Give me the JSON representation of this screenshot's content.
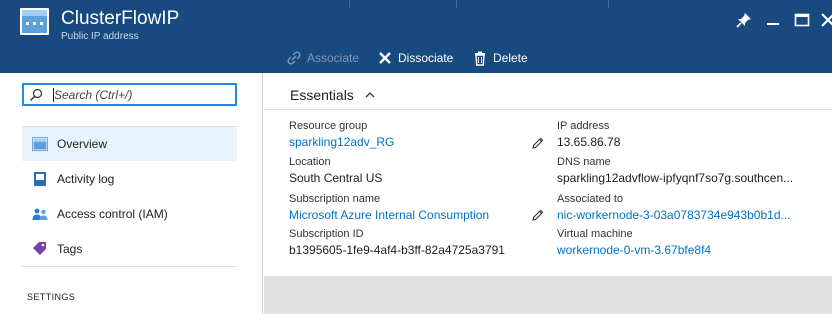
{
  "blade": {
    "title": "ClusterFlowIP",
    "subtitle": "Public IP address",
    "icon": "public-ip-icon"
  },
  "window_controls": [
    "pin-icon",
    "minimize-icon",
    "maximize-icon",
    "close-icon"
  ],
  "toolbar": {
    "associate_label": "Associate",
    "dissociate_label": "Dissociate",
    "delete_label": "Delete"
  },
  "search": {
    "placeholder": "Search (Ctrl+/)",
    "value": ""
  },
  "nav": {
    "items": [
      {
        "label": "Overview",
        "icon": "overview-icon",
        "active": true
      },
      {
        "label": "Activity log",
        "icon": "activity-log-icon",
        "active": false
      },
      {
        "label": "Access control (IAM)",
        "icon": "access-control-icon",
        "active": false
      },
      {
        "label": "Tags",
        "icon": "tag-icon",
        "active": false
      }
    ],
    "section_settings": "SETTINGS"
  },
  "essentials": {
    "header": "Essentials",
    "left": [
      {
        "label": "Resource group",
        "value": "sparkling12adv_RG",
        "link": true
      },
      {
        "label": "Location",
        "value": "South Central US",
        "link": false
      },
      {
        "label": "Subscription name",
        "value": "Microsoft Azure Internal Consumption",
        "link": true
      },
      {
        "label": "Subscription ID",
        "value": "b1395605-1fe9-4af4-b3ff-82a4725a3791",
        "link": false
      }
    ],
    "right": [
      {
        "label": "IP address",
        "value": "13.65.86.78",
        "link": false
      },
      {
        "label": "DNS name",
        "value": "sparkling12advflow-ipfyqnf7so7g.southcen...",
        "link": false
      },
      {
        "label": "Associated to",
        "value": "nic-workernode-3-03a0783734e943b0b1d...",
        "link": true
      },
      {
        "label": "Virtual machine",
        "value": "workernode-0-vm-3.67bfe8f4",
        "link": true
      }
    ]
  },
  "colors": {
    "header_bg": "#184a7f",
    "link": "#0072c6",
    "focus_border": "#2b88d8",
    "active_nav": "#e7f3fd"
  }
}
